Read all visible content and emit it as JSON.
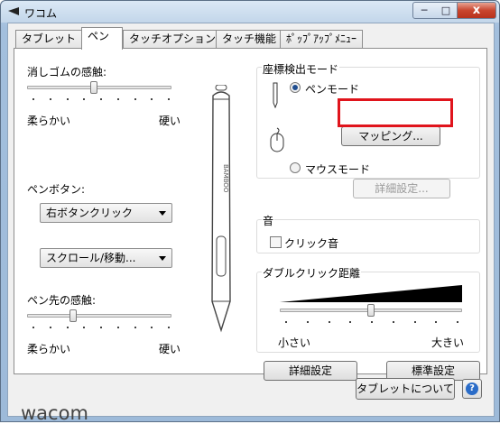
{
  "window": {
    "title": "ワコム",
    "controls": {
      "minimize": "─",
      "maximize": "□",
      "close": "x"
    }
  },
  "tabs": [
    {
      "label": "タブレット",
      "active": false
    },
    {
      "label": "ペン",
      "active": true
    },
    {
      "label": "タッチオプション",
      "active": false
    },
    {
      "label": "タッチ機能",
      "active": false
    },
    {
      "label": "ﾎﾟｯﾌﾟｱｯﾌﾟﾒﾆｭｰ",
      "active": false
    }
  ],
  "eraser_feel": {
    "label": "消しゴムの感触:",
    "min_label": "柔らかい",
    "max_label": "硬い",
    "level_fraction": 0.45
  },
  "pen_button": {
    "label": "ペンボタン:",
    "upper_value": "右ボタンクリック",
    "lower_value": "スクロール/移動..."
  },
  "tip_feel": {
    "label": "ペン先の感触:",
    "min_label": "柔らかい",
    "max_label": "硬い",
    "level_fraction": 0.3
  },
  "pen_image": {
    "brand_text": "BAMBOO"
  },
  "mode_group": {
    "title": "座標検出モード",
    "pen_mode_label": "ペンモード",
    "pen_mode_selected": true,
    "mapping_button": "マッピング...",
    "mouse_mode_label": "マウスモード",
    "mouse_mode_selected": false,
    "details_button": "詳細設定..."
  },
  "sound_group": {
    "title": "音",
    "click_sound_label": "クリック音",
    "click_sound_checked": false
  },
  "double_click": {
    "title": "ダブルクリック距離",
    "min_label": "小さい",
    "max_label": "大きい",
    "level_fraction": 0.5
  },
  "buttons": {
    "advanced": "詳細設定",
    "defaults": "標準設定",
    "about": "タブレットについて"
  },
  "footer": {
    "logo_text": "wacom",
    "help_glyph": "?"
  },
  "colors": {
    "highlight": "#e0141c",
    "title_bar": "#c3d6ea",
    "slider_wedge": "#000000"
  }
}
